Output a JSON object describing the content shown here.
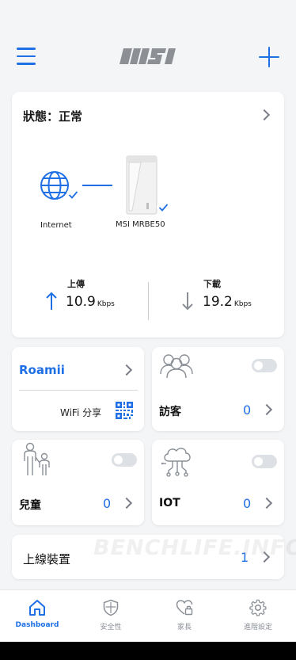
{
  "header": {
    "logo_text": "MSI",
    "menu_icon": "hamburger-menu-icon",
    "add_icon": "plus-icon",
    "accent_color": "#1f6fe5"
  },
  "status": {
    "title": "狀態：正常",
    "internet_label": "Internet",
    "router_label": "MSI MRBE50",
    "upload": {
      "label": "上傳",
      "value": "10.9",
      "unit": "Kbps"
    },
    "download": {
      "label": "下載",
      "value": "19.2",
      "unit": "Kbps"
    }
  },
  "roamii": {
    "title": "Roamii",
    "wifi_share_label": "WiFi 分享"
  },
  "guest": {
    "label": "訪客",
    "count": "0",
    "enabled": false
  },
  "kids": {
    "label": "兒童",
    "count": "0",
    "enabled": false
  },
  "iot": {
    "label": "IOT",
    "count": "0",
    "enabled": false
  },
  "devices": {
    "label": "上線裝置",
    "count": "1"
  },
  "watermark": "BENCHLIFE.INFO",
  "bottom_nav": [
    {
      "label": "Dashboard",
      "icon": "home-icon",
      "active": true
    },
    {
      "label": "安全性",
      "icon": "shield-icon",
      "active": false
    },
    {
      "label": "家長",
      "icon": "heart-lock-icon",
      "active": false
    },
    {
      "label": "進階設定",
      "icon": "gear-icon",
      "active": false
    }
  ]
}
